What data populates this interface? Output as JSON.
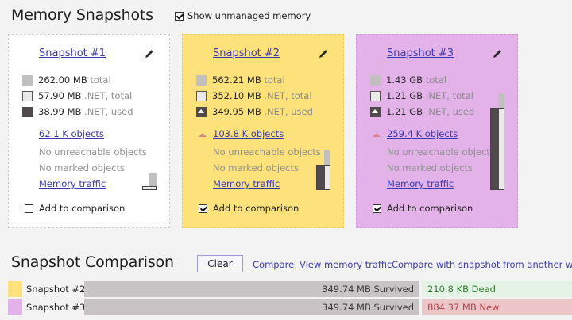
{
  "header": {
    "title": "Memory Snapshots",
    "show_unmanaged_label": "Show unmanaged memory",
    "show_unmanaged_checked": true
  },
  "snapshots": [
    {
      "title": "Snapshot #1",
      "total_value": "262.00 MB",
      "total_label": "total",
      "net_total_value": "57.90 MB",
      "net_total_label": ".NET, total",
      "net_used_value": "38.99 MB",
      "net_used_label": ".NET, used",
      "objects": "62.1 K objects",
      "unreachable": "No unreachable objects",
      "marked": "No marked objects",
      "traffic": "Memory traffic",
      "add_label": "Add to comparison",
      "add_checked": false,
      "color": "#ffffff"
    },
    {
      "title": "Snapshot #2",
      "total_value": "562.21 MB",
      "total_label": "total",
      "net_total_value": "352.10 MB",
      "net_total_label": ".NET, total",
      "net_used_value": "349.95 MB",
      "net_used_label": ".NET, used",
      "objects": "103.8 K objects",
      "unreachable": "No unreachable objects",
      "marked": "No marked objects",
      "traffic": "Memory traffic",
      "add_label": "Add to comparison",
      "add_checked": true,
      "color": "#fde27b"
    },
    {
      "title": "Snapshot #3",
      "total_value": "1.43 GB",
      "total_label": "total",
      "net_total_value": "1.21 GB",
      "net_total_label": ".NET, total",
      "net_used_value": "1.21 GB",
      "net_used_label": ".NET, used",
      "objects": "259.4 K objects",
      "unreachable": "No unreachable objects",
      "marked": "No marked objects",
      "traffic": "Memory traffic",
      "add_label": "Add to comparison",
      "add_checked": true,
      "color": "#e3b2e9"
    }
  ],
  "comparison": {
    "title": "Snapshot Comparison",
    "clear_label": "Clear",
    "compare_label": "Compare",
    "view_traffic_label": "View memory traffic",
    "compare_other_label": "Compare with snapshot from another work",
    "rows": [
      {
        "name": "Snapshot #2",
        "survived": "349.74 MB Survived",
        "delta": "210.8 KB Dead",
        "color": "#fde27b"
      },
      {
        "name": "Snapshot #3",
        "survived": "349.74 MB Survived",
        "delta": "884.37 MB New",
        "color": "#e3b2e9"
      }
    ]
  }
}
